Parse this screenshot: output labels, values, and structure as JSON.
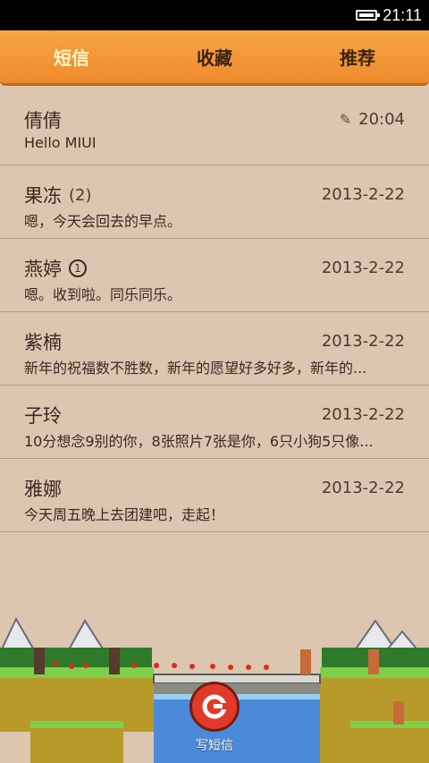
{
  "status": {
    "time": "21:11",
    "battery_icon": "battery-full-icon"
  },
  "tabs": [
    {
      "label": "短信",
      "active": true
    },
    {
      "label": "收藏",
      "active": false
    },
    {
      "label": "推荐",
      "active": false
    }
  ],
  "messages": [
    {
      "name": "倩倩",
      "count": "",
      "unread": "",
      "date": "20:04",
      "draft": true,
      "preview": "Hello MIUI"
    },
    {
      "name": "果冻",
      "count": "(2)",
      "unread": "",
      "date": "2013-2-22",
      "draft": false,
      "preview": "嗯，今天会回去的早点。"
    },
    {
      "name": "燕婷",
      "count": "",
      "unread": "1",
      "date": "2013-2-22",
      "draft": false,
      "preview": "嗯。收到啦。同乐同乐。"
    },
    {
      "name": "紫楠",
      "count": "",
      "unread": "",
      "date": "2013-2-22",
      "draft": false,
      "preview": "新年的祝福数不胜数，新年的愿望好多好多，新年的..."
    },
    {
      "name": "子玲",
      "count": "",
      "unread": "",
      "date": "2013-2-22",
      "draft": false,
      "preview": "10分想念9别的你，8张照片7张是你，6只小狗5只像..."
    },
    {
      "name": "雅娜",
      "count": "",
      "unread": "",
      "date": "2013-2-22",
      "draft": false,
      "preview": "今天周五晚上去团建吧，走起！"
    }
  ],
  "compose": {
    "label": "写短信",
    "icon": "compose-icon"
  },
  "colors": {
    "tab_bar": "#ee8a2c",
    "active_tab_text": "#fff6c8",
    "background": "#dcc6b0",
    "compose_button": "#e23a2a"
  }
}
